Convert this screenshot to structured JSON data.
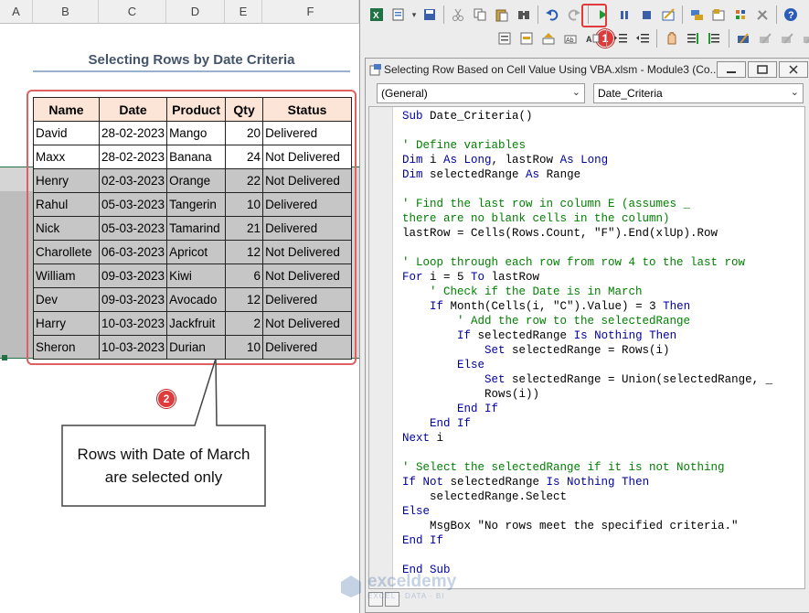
{
  "sheet": {
    "columns": [
      "A",
      "B",
      "C",
      "D",
      "E",
      "F"
    ],
    "title": "Selecting Rows by Date Criteria",
    "headers": [
      "Name",
      "Date",
      "Product",
      "Qty",
      "Status"
    ],
    "rows": [
      {
        "name": "David",
        "date": "28-02-2023",
        "product": "Mango",
        "qty": "20",
        "status": "Delivered",
        "selected": false
      },
      {
        "name": "Maxx",
        "date": "28-02-2023",
        "product": "Banana",
        "qty": "24",
        "status": "Not Delivered",
        "selected": false
      },
      {
        "name": "Henry",
        "date": "02-03-2023",
        "product": "Orange",
        "qty": "22",
        "status": "Not Delivered",
        "selected": true
      },
      {
        "name": "Rahul",
        "date": "05-03-2023",
        "product": "Tangerin",
        "qty": "10",
        "status": "Delivered",
        "selected": true
      },
      {
        "name": "Nick",
        "date": "05-03-2023",
        "product": "Tamarind",
        "qty": "21",
        "status": "Delivered",
        "selected": true
      },
      {
        "name": "Charollete",
        "date": "06-03-2023",
        "product": "Apricot",
        "qty": "12",
        "status": "Not Delivered",
        "selected": true
      },
      {
        "name": "William",
        "date": "09-03-2023",
        "product": "Kiwi",
        "qty": "6",
        "status": "Not Delivered",
        "selected": true
      },
      {
        "name": "Dev",
        "date": "09-03-2023",
        "product": "Avocado",
        "qty": "12",
        "status": "Delivered",
        "selected": true
      },
      {
        "name": "Harry",
        "date": "10-03-2023",
        "product": "Jackfruit",
        "qty": "2",
        "status": "Not Delivered",
        "selected": true
      },
      {
        "name": "Sheron",
        "date": "10-03-2023",
        "product": "Durian",
        "qty": "10",
        "status": "Delivered",
        "selected": true
      }
    ],
    "callout": {
      "line1": "Rows with Date of March",
      "line2": "are selected only"
    },
    "badge2": "2"
  },
  "vbe": {
    "badge1": "1",
    "toolbar1_icons": [
      "excel-icon",
      "insert-module-icon",
      "save-icon",
      "cut-icon",
      "copy-icon",
      "paste-icon",
      "find-icon",
      "undo-icon",
      "redo-icon",
      "run-icon",
      "break-icon",
      "reset-icon",
      "design-mode-icon",
      "project-explorer-icon",
      "properties-icon",
      "object-browser-icon",
      "toolbox-icon",
      "help-icon"
    ],
    "window_title": "Selecting Row Based on Cell Value Using VBA.xlsm - Module3 (Co...",
    "object_dropdown": "(General)",
    "procedure_dropdown": "Date_Criteria",
    "code": [
      [
        [
          "k",
          "Sub "
        ],
        [
          "p",
          "Date_Criteria()"
        ]
      ],
      [],
      [
        [
          "c",
          "' Define variables"
        ]
      ],
      [
        [
          "k",
          "Dim "
        ],
        [
          "p",
          "i "
        ],
        [
          "k",
          "As Long"
        ],
        [
          "p",
          ", lastRow "
        ],
        [
          "k",
          "As Long"
        ]
      ],
      [
        [
          "k",
          "Dim "
        ],
        [
          "p",
          "selectedRange "
        ],
        [
          "k",
          "As "
        ],
        [
          "p",
          "Range"
        ]
      ],
      [],
      [
        [
          "c",
          "' Find the last row in column E (assumes _"
        ]
      ],
      [
        [
          "c",
          "there are no blank cells in the column)"
        ]
      ],
      [
        [
          "p",
          "lastRow = Cells(Rows.Count, \"F\").End(xlUp).Row"
        ]
      ],
      [],
      [
        [
          "c",
          "' Loop through each row from row 4 to the last row"
        ]
      ],
      [
        [
          "k",
          "For "
        ],
        [
          "p",
          "i = 5 "
        ],
        [
          "k",
          "To "
        ],
        [
          "p",
          "lastRow"
        ]
      ],
      [
        [
          "c",
          "    ' Check if the Date is in March"
        ]
      ],
      [
        [
          "p",
          "    "
        ],
        [
          "k",
          "If "
        ],
        [
          "p",
          "Month(Cells(i, \"C\").Value) = 3 "
        ],
        [
          "k",
          "Then"
        ]
      ],
      [
        [
          "c",
          "        ' Add the row to the selectedRange"
        ]
      ],
      [
        [
          "p",
          "        "
        ],
        [
          "k",
          "If "
        ],
        [
          "p",
          "selectedRange "
        ],
        [
          "k",
          "Is Nothing Then"
        ]
      ],
      [
        [
          "p",
          "            "
        ],
        [
          "k",
          "Set "
        ],
        [
          "p",
          "selectedRange = Rows(i)"
        ]
      ],
      [
        [
          "p",
          "        "
        ],
        [
          "k",
          "Else"
        ]
      ],
      [
        [
          "p",
          "            "
        ],
        [
          "k",
          "Set "
        ],
        [
          "p",
          "selectedRange = Union(selectedRange, _"
        ]
      ],
      [
        [
          "p",
          "            Rows(i))"
        ]
      ],
      [
        [
          "p",
          "        "
        ],
        [
          "k",
          "End If"
        ]
      ],
      [
        [
          "p",
          "    "
        ],
        [
          "k",
          "End If"
        ]
      ],
      [
        [
          "k",
          "Next "
        ],
        [
          "p",
          "i"
        ]
      ],
      [],
      [
        [
          "c",
          "' Select the selectedRange if it is not Nothing"
        ]
      ],
      [
        [
          "k",
          "If Not "
        ],
        [
          "p",
          "selectedRange "
        ],
        [
          "k",
          "Is Nothing Then"
        ]
      ],
      [
        [
          "p",
          "    selectedRange.Select"
        ]
      ],
      [
        [
          "k",
          "Else"
        ]
      ],
      [
        [
          "p",
          "    MsgBox \"No rows meet the specified criteria.\""
        ]
      ],
      [
        [
          "k",
          "End If"
        ]
      ],
      [],
      [
        [
          "k",
          "End Sub"
        ]
      ]
    ]
  },
  "watermark": {
    "name": "exceldemy",
    "sub": "EXCEL · DATA · BI"
  }
}
